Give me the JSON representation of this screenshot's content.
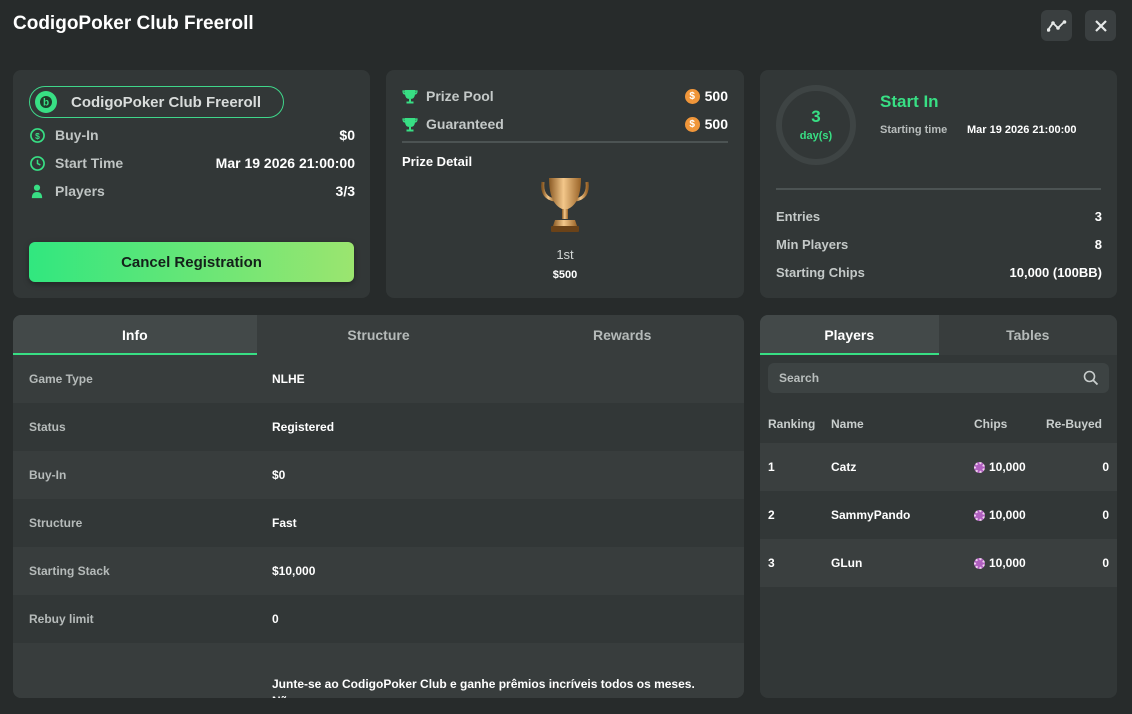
{
  "header": {
    "title": "CodigoPoker Club Freeroll",
    "stats_icon": "chart-line-icon",
    "close_icon": "close-icon"
  },
  "summary": {
    "name": "CodigoPoker Club Freeroll",
    "buyin_label": "Buy-In",
    "buyin_value": "$0",
    "start_label": "Start Time",
    "start_value": "Mar 19 2026 21:00:00",
    "players_label": "Players",
    "players_value": "3/3",
    "cancel_label": "Cancel Registration"
  },
  "prize": {
    "pool_label": "Prize Pool",
    "pool_value": "500",
    "guaranteed_label": "Guaranteed",
    "guaranteed_value": "500",
    "detail_label": "Prize Detail",
    "place": "1st",
    "place_amount": "$500"
  },
  "countdown": {
    "number": "3",
    "unit": "day(s)",
    "start_in": "Start In",
    "starting_time_label": "Starting time",
    "starting_time_value": "Mar 19 2026 21:00:00",
    "entries_label": "Entries",
    "entries_value": "3",
    "min_players_label": "Min Players",
    "min_players_value": "8",
    "starting_chips_label": "Starting Chips",
    "starting_chips_value": "10,000 (100BB)"
  },
  "info_tabs": [
    "Info",
    "Structure",
    "Rewards"
  ],
  "info_rows": [
    {
      "key": "Game Type",
      "value": "NLHE"
    },
    {
      "key": "Status",
      "value": "Registered"
    },
    {
      "key": "Buy-In",
      "value": "$0"
    },
    {
      "key": "Structure",
      "value": "Fast"
    },
    {
      "key": "Starting Stack",
      "value": "$10,000"
    },
    {
      "key": "Rebuy limit",
      "value": "0"
    }
  ],
  "description": "Junte-se ao CodigoPoker Club e ganhe prêmios incríveis todos os meses. Não",
  "players_tabs": [
    "Players",
    "Tables"
  ],
  "search": {
    "placeholder": "Search"
  },
  "players_table": {
    "headers": [
      "Ranking",
      "Name",
      "Chips",
      "Re-Buyed"
    ],
    "rows": [
      {
        "rank": "1",
        "name": "Catz",
        "chips": "10,000",
        "rebuy": "0"
      },
      {
        "rank": "2",
        "name": "SammyPando",
        "chips": "10,000",
        "rebuy": "0"
      },
      {
        "rank": "3",
        "name": "GLun",
        "chips": "10,000",
        "rebuy": "0"
      }
    ]
  },
  "colors": {
    "accent": "#38df84",
    "coin": "#f0963a",
    "background": "#272b2b",
    "card": "#323737"
  }
}
